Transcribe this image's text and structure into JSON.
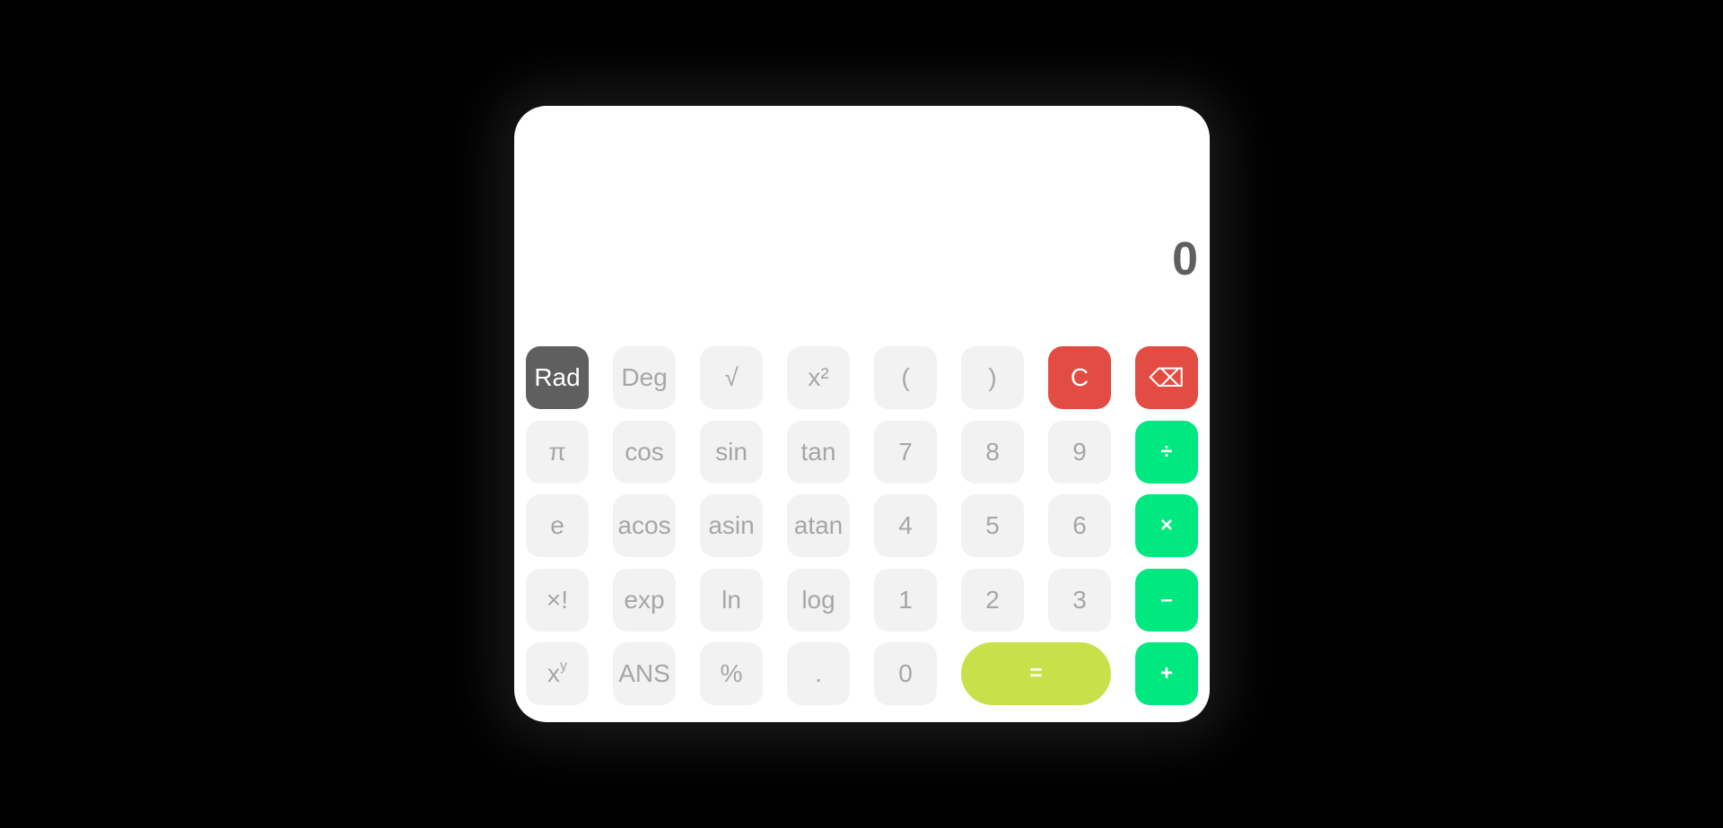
{
  "display": {
    "value": "0"
  },
  "keys": {
    "rad": "Rad",
    "deg": "Deg",
    "sqrt": "√",
    "square": "x²",
    "lparen": "(",
    "rparen": ")",
    "clear": "C",
    "backspace": "⌫",
    "pi": "π",
    "cos": "cos",
    "sin": "sin",
    "tan": "tan",
    "seven": "7",
    "eight": "8",
    "nine": "9",
    "divide": "÷",
    "e": "e",
    "acos": "acos",
    "asin": "asin",
    "atan": "atan",
    "four": "4",
    "five": "5",
    "six": "6",
    "multiply": "×",
    "factorial": "×!",
    "exp": "exp",
    "ln": "ln",
    "log": "log",
    "one": "1",
    "two": "2",
    "three": "3",
    "minus": "–",
    "power_base": "x",
    "power_exp": "y",
    "ans": "ANS",
    "percent": "%",
    "decimal": ".",
    "zero": "0",
    "equals": "=",
    "plus": "+"
  },
  "colors": {
    "background": "#000000",
    "panel": "#ffffff",
    "key": "#f2f2f2",
    "key_text": "#a6a6a6",
    "active_mode": "#5f5f5f",
    "clear": "#e24c43",
    "operator": "#00e880",
    "equals": "#c8e04a"
  }
}
